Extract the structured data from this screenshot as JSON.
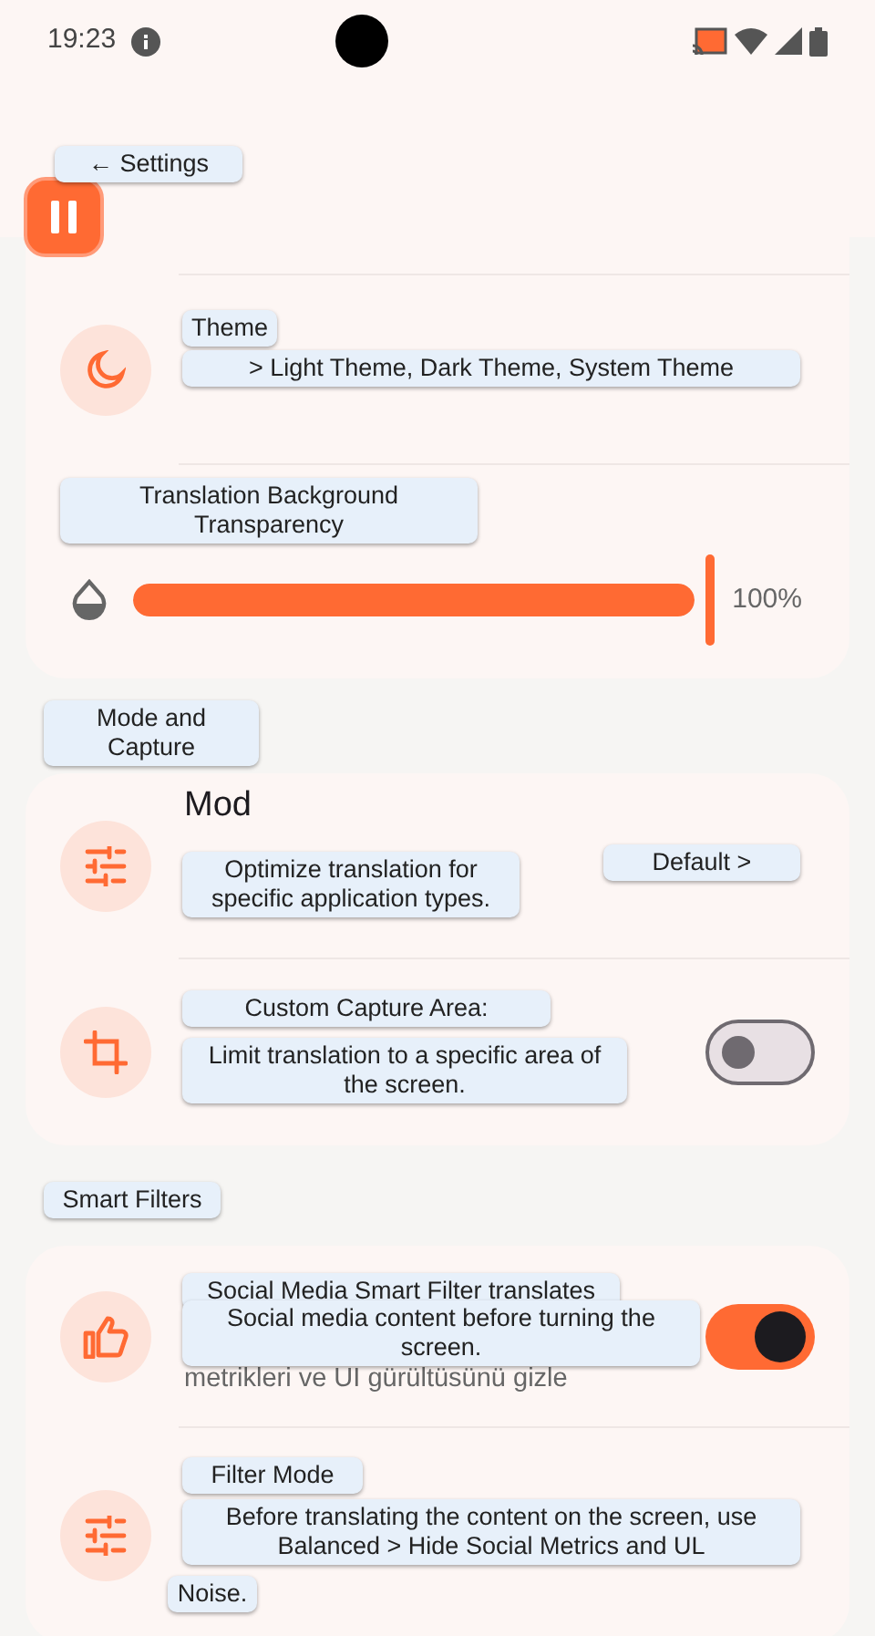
{
  "status_bar": {
    "time": "19:23"
  },
  "sections": [
    {
      "items": [
        {
          "kind": "link"
        },
        {
          "kind": "slider",
          "level": 1,
          "reading": "100%"
        }
      ]
    },
    {
      "items": [
        {
          "kind": "link",
          "title": "Mod"
        },
        {
          "kind": "toggle",
          "on": false
        }
      ]
    },
    {
      "items": [
        {
          "kind": "toggle",
          "on": true,
          "subtitle": "metrikleri ve UI gürültüsünü gizle"
        },
        {
          "kind": "link"
        }
      ]
    }
  ],
  "translation_overlays": [
    {
      "text": "← Settings"
    },
    {
      "text": "Theme"
    },
    {
      "text": "> Light Theme, Dark Theme, System Theme"
    },
    {
      "text": "Translation Background Transparency"
    },
    {
      "text": "Mode and Capture"
    },
    {
      "text": "Optimize translation for specific application types."
    },
    {
      "text": "Default >"
    },
    {
      "text": "Custom Capture Area:"
    },
    {
      "text": "Limit translation to a specific area of the screen."
    },
    {
      "text": "Smart Filters"
    },
    {
      "text": "Social Media Smart Filter translates"
    },
    {
      "text": "Social media content before turning the screen."
    },
    {
      "text": "Filter Mode"
    },
    {
      "text": "Before translating the content on the screen, use Balanced > Hide Social Metrics and UL"
    },
    {
      "text": "Noise."
    }
  ]
}
